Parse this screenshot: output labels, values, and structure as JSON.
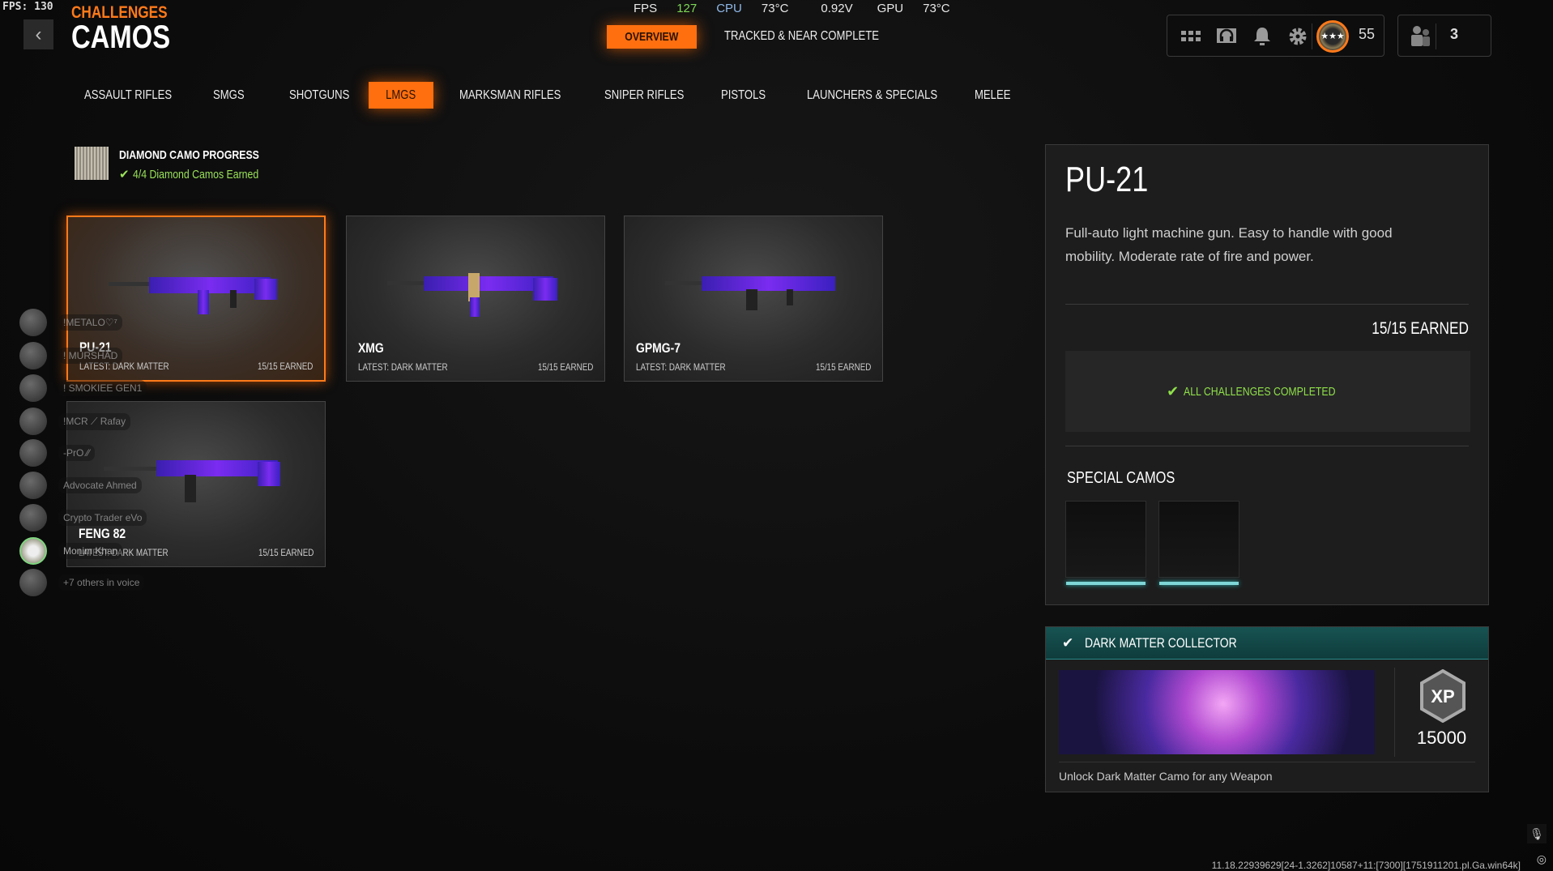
{
  "overlay": {
    "fps_label": "FPS: 130",
    "stats": [
      {
        "text": "FPS",
        "color": "#e8e8e8"
      },
      {
        "text": "127",
        "color": "#7ed957"
      },
      {
        "text": "CPU",
        "color": "#8fb8e8"
      },
      {
        "text": "73°C",
        "color": "#e8e8e8"
      },
      {
        "text": "0.92V",
        "color": "#e8e8e8"
      },
      {
        "text": "GPU",
        "color": "#e8e8e8"
      },
      {
        "text": "73°C",
        "color": "#e8e8e8"
      }
    ],
    "version": "11.18.22939629[24-1.3262]10587+11:[7300][1751911201.pl.Ga.win64k]"
  },
  "header": {
    "breadcrumb": "CHALLENGES",
    "title": "CAMOS",
    "back_icon": "‹",
    "tabs": [
      {
        "label": "OVERVIEW",
        "active": true
      },
      {
        "label": "TRACKED & NEAR COMPLETE",
        "active": false
      }
    ],
    "level": "55",
    "party_count": "3"
  },
  "categories": [
    {
      "label": "ASSAULT RIFLES"
    },
    {
      "label": "SMGS"
    },
    {
      "label": "SHOTGUNS"
    },
    {
      "label": "LMGS",
      "active": true
    },
    {
      "label": "MARKSMAN RIFLES"
    },
    {
      "label": "SNIPER RIFLES"
    },
    {
      "label": "PISTOLS"
    },
    {
      "label": "LAUNCHERS & SPECIALS"
    },
    {
      "label": "MELEE"
    }
  ],
  "diamond": {
    "title": "DIAMOND CAMO PROGRESS",
    "status": "4/4 Diamond Camos Earned"
  },
  "weapons": [
    {
      "name": "PU-21",
      "latest": "LATEST: DARK MATTER",
      "earned": "15/15 EARNED",
      "selected": true
    },
    {
      "name": "XMG",
      "latest": "LATEST: DARK MATTER",
      "earned": "15/15 EARNED"
    },
    {
      "name": "GPMG-7",
      "latest": "LATEST: DARK MATTER",
      "earned": "15/15 EARNED"
    },
    {
      "name": "FENG 82",
      "latest": "LATEST: DARK MATTER",
      "earned": "15/15 EARNED"
    }
  ],
  "detail": {
    "name": "PU-21",
    "description": "Full-auto light machine gun.  Easy to handle with good mobility. Moderate rate of fire and power.",
    "earned": "15/15 EARNED",
    "status": "ALL CHALLENGES COMPLETED",
    "special_title": "SPECIAL CAMOS"
  },
  "reward": {
    "title": "DARK MATTER COLLECTOR",
    "xp": "15000",
    "xp_badge": "XP",
    "description": "Unlock Dark Matter Camo for any Weapon"
  },
  "voice": {
    "members": [
      "!METALO♡⁷",
      "! MURSHAD",
      "! SMOKIEE  GEN1",
      "!MCR ⟋ Rafay",
      "-PrO ⁄⁄",
      "Advocate Ahmed",
      "Crypto Trader  eVo",
      "Monim Khan"
    ],
    "others": "+7 others in voice"
  },
  "colors": {
    "accent": "#ff6f0f",
    "success": "#8fe04a",
    "teal": "#175352"
  }
}
